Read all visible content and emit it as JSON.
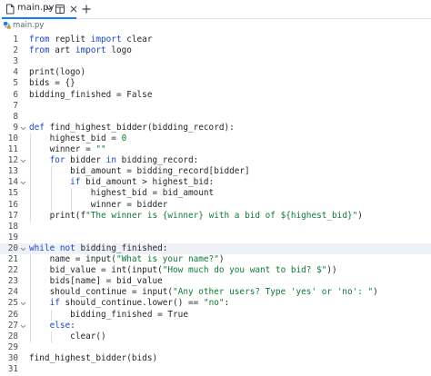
{
  "tab": {
    "filename": "main.py"
  },
  "breadcrumb": {
    "file": "main.py"
  },
  "colors": {
    "accent": "#0f7bff",
    "keyword": "#1a47c4",
    "string": "#0f7a36"
  },
  "editor": {
    "current_line": 20,
    "lines": [
      {
        "n": "1",
        "fold": false,
        "text": "from replit import clear"
      },
      {
        "n": "2",
        "fold": false,
        "text": "from art import logo"
      },
      {
        "n": "3",
        "fold": false,
        "text": ""
      },
      {
        "n": "4",
        "fold": false,
        "text": "print(logo)"
      },
      {
        "n": "5",
        "fold": false,
        "text": "bids = {}"
      },
      {
        "n": "6",
        "fold": false,
        "text": "bidding_finished = False"
      },
      {
        "n": "7",
        "fold": false,
        "text": ""
      },
      {
        "n": "8",
        "fold": false,
        "text": ""
      },
      {
        "n": "9",
        "fold": true,
        "text": "def find_highest_bidder(bidding_record):"
      },
      {
        "n": "10",
        "fold": false,
        "text": "    highest_bid = 0"
      },
      {
        "n": "11",
        "fold": false,
        "text": "    winner = \"\""
      },
      {
        "n": "12",
        "fold": true,
        "text": "    for bidder in bidding_record:"
      },
      {
        "n": "13",
        "fold": false,
        "text": "        bid_amount = bidding_record[bidder]"
      },
      {
        "n": "14",
        "fold": true,
        "text": "        if bid_amount > highest_bid:"
      },
      {
        "n": "15",
        "fold": false,
        "text": "            highest_bid = bid_amount"
      },
      {
        "n": "16",
        "fold": false,
        "text": "            winner = bidder"
      },
      {
        "n": "17",
        "fold": false,
        "text": "    print(f\"The winner is {winner} with a bid of ${highest_bid}\")"
      },
      {
        "n": "18",
        "fold": false,
        "text": ""
      },
      {
        "n": "19",
        "fold": false,
        "text": ""
      },
      {
        "n": "20",
        "fold": true,
        "text": "while not bidding_finished:"
      },
      {
        "n": "21",
        "fold": false,
        "text": "    name = input(\"What is your name?\")"
      },
      {
        "n": "22",
        "fold": false,
        "text": "    bid_value = int(input(\"How much do you want to bid? $\"))"
      },
      {
        "n": "23",
        "fold": false,
        "text": "    bids[name] = bid_value"
      },
      {
        "n": "24",
        "fold": false,
        "text": "    should_continue = input(\"Any other users? Type 'yes' or 'no': \")"
      },
      {
        "n": "25",
        "fold": true,
        "text": "    if should_continue.lower() == \"no\":"
      },
      {
        "n": "26",
        "fold": false,
        "text": "        bidding_finished = True"
      },
      {
        "n": "27",
        "fold": true,
        "text": "    else:"
      },
      {
        "n": "28",
        "fold": false,
        "text": "        clear()"
      },
      {
        "n": "29",
        "fold": false,
        "text": ""
      },
      {
        "n": "30",
        "fold": false,
        "text": "find_highest_bidder(bids)"
      },
      {
        "n": "31",
        "fold": false,
        "text": ""
      }
    ]
  }
}
